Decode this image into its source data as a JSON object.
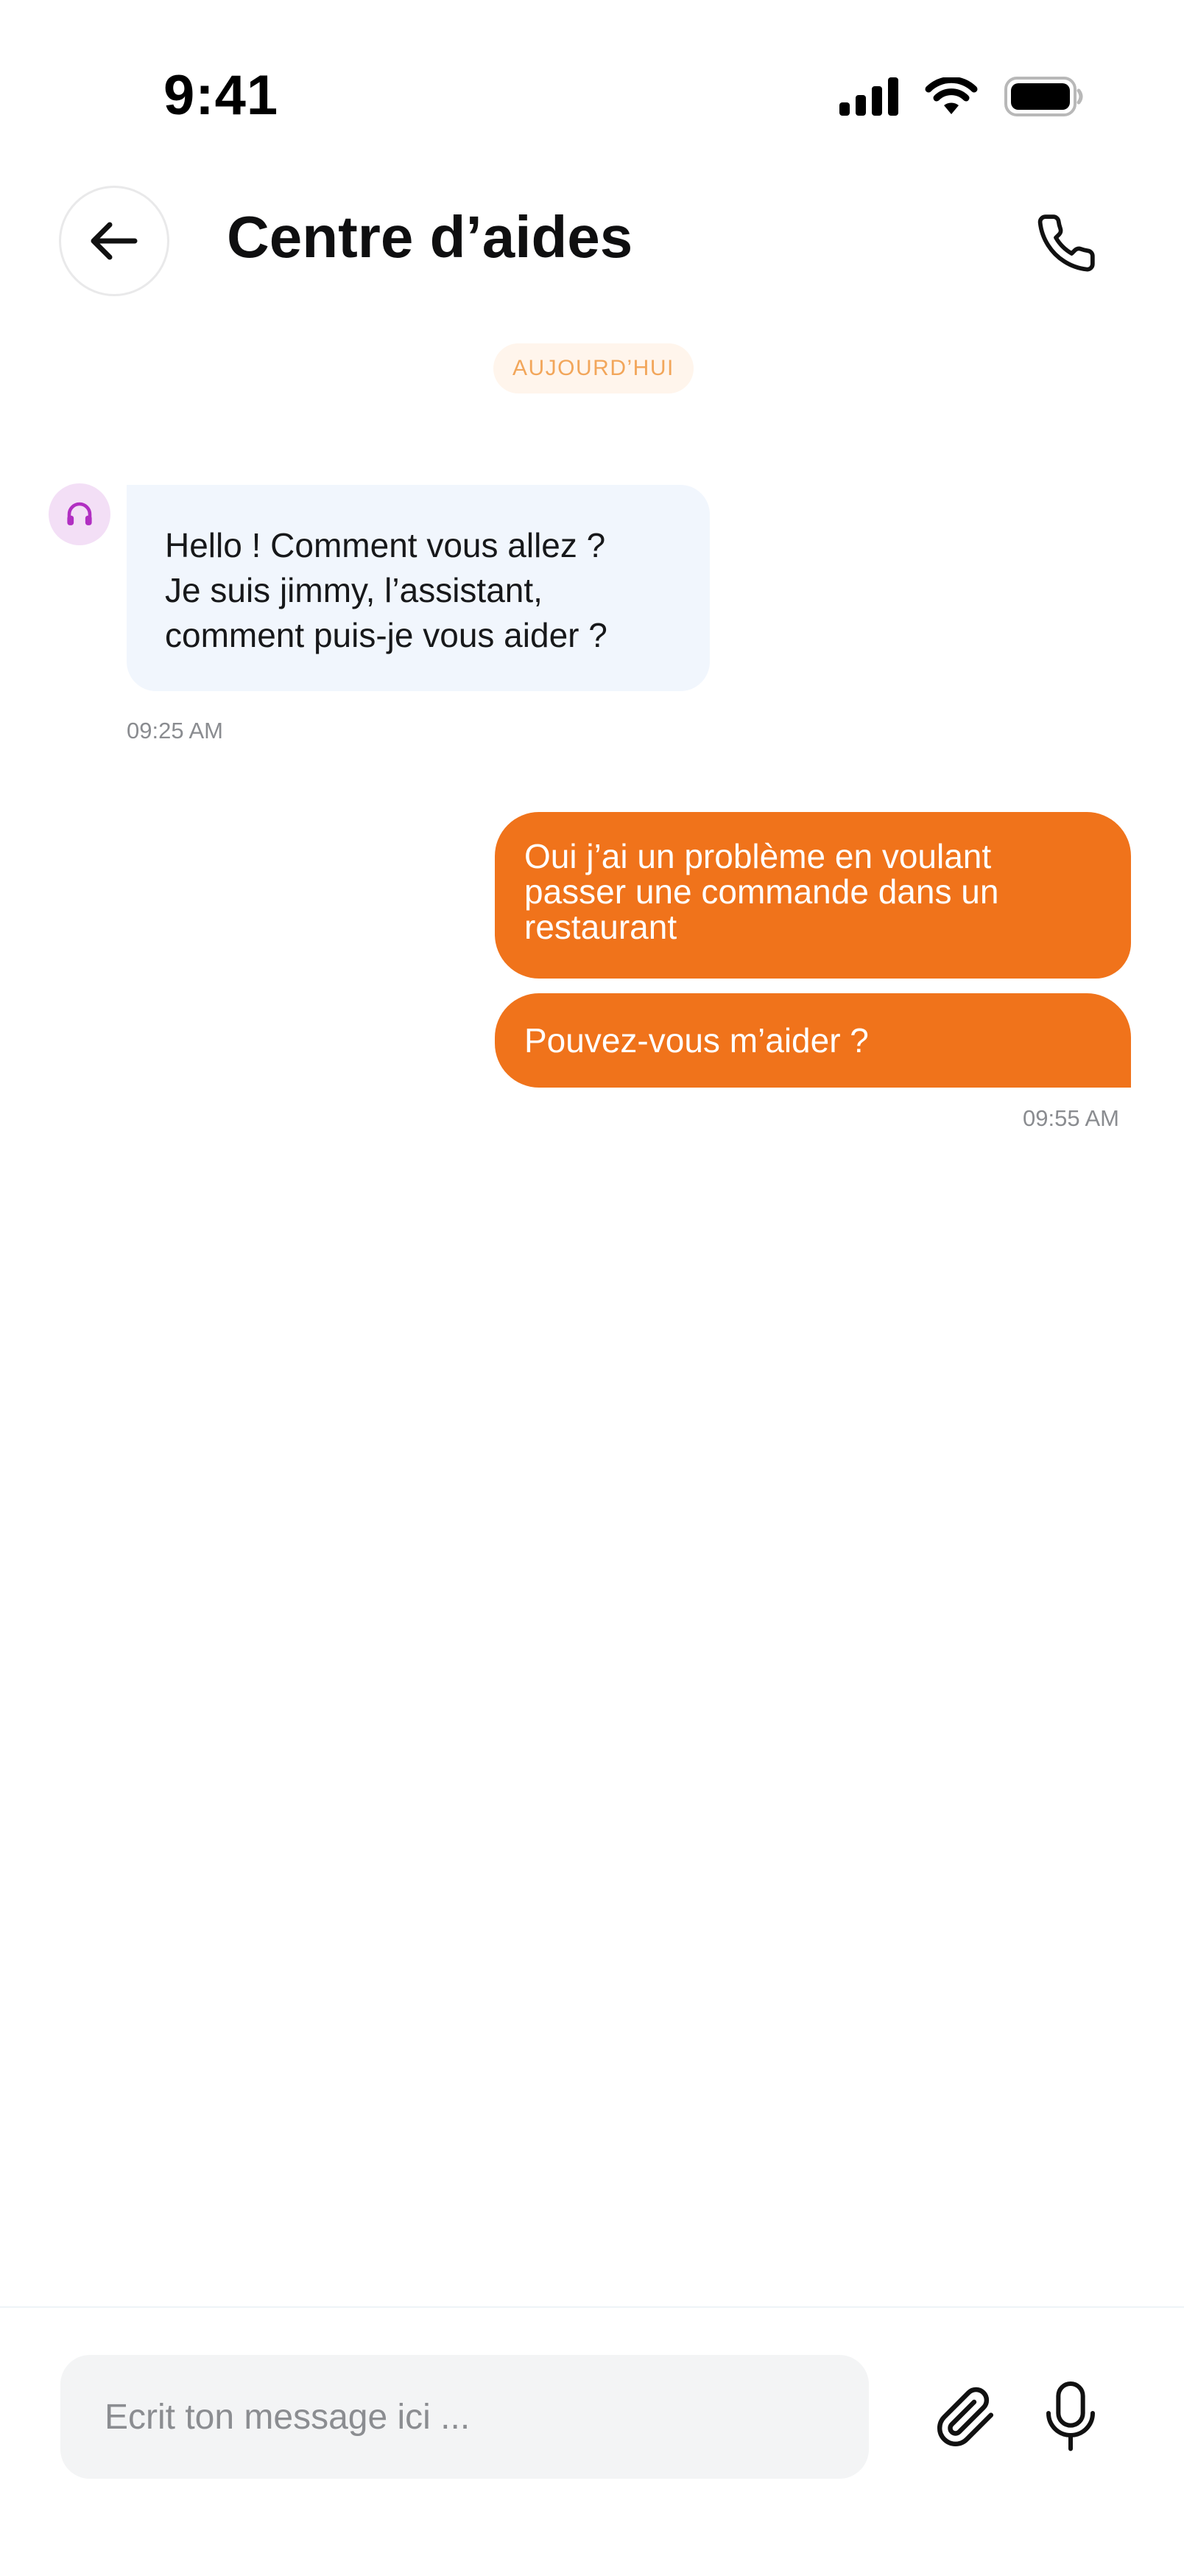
{
  "status_bar": {
    "time": "9:41"
  },
  "header": {
    "title": "Centre d’aides"
  },
  "chat": {
    "date_separator": "AUJOURD’HUI",
    "incoming": {
      "lines": [
        "Hello ! Comment vous allez ?",
        "Je suis jimmy, l’assistant,",
        "comment puis-je vous aider ?"
      ],
      "time": "09:25 AM"
    },
    "outgoing": [
      {
        "lines": [
          "Oui j’ai un problème en voulant",
          "passer une commande dans un",
          "restaurant"
        ]
      },
      {
        "text": "Pouvez-vous m’aider ?"
      }
    ],
    "outgoing_time": "09:55 AM"
  },
  "composer": {
    "placeholder": "Ecrit ton message ici ...",
    "value": ""
  },
  "icons": {
    "back": "arrow-left-icon",
    "call": "phone-icon",
    "agent": "headset-icon",
    "attach": "paperclip-icon",
    "mic": "microphone-icon"
  },
  "colors": {
    "accent": "#f0731b",
    "incoming_bubble": "#f1f6fd",
    "date_chip_bg": "#fff5ec",
    "date_chip_text": "#f2a65a",
    "avatar_bg": "#f3dff6",
    "avatar_icon": "#b12fc2"
  }
}
